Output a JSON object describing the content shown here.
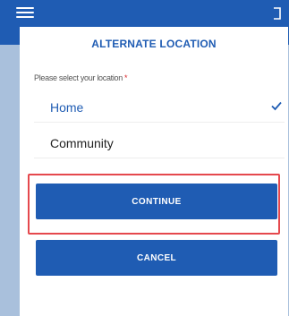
{
  "dialog": {
    "title": "ALTERNATE LOCATION",
    "field_label": "Please select your location",
    "required_mark": "*",
    "options": [
      {
        "label": "Home",
        "selected": true
      },
      {
        "label": "Community",
        "selected": false
      }
    ],
    "continue_label": "CONTINUE",
    "cancel_label": "CANCEL"
  },
  "icons": {
    "menu": "hamburger-icon",
    "exit": "exit-icon",
    "selected": "check-icon"
  },
  "colors": {
    "brand": "#1f5cb3",
    "required": "#d9262a",
    "highlight": "#e5484d"
  }
}
